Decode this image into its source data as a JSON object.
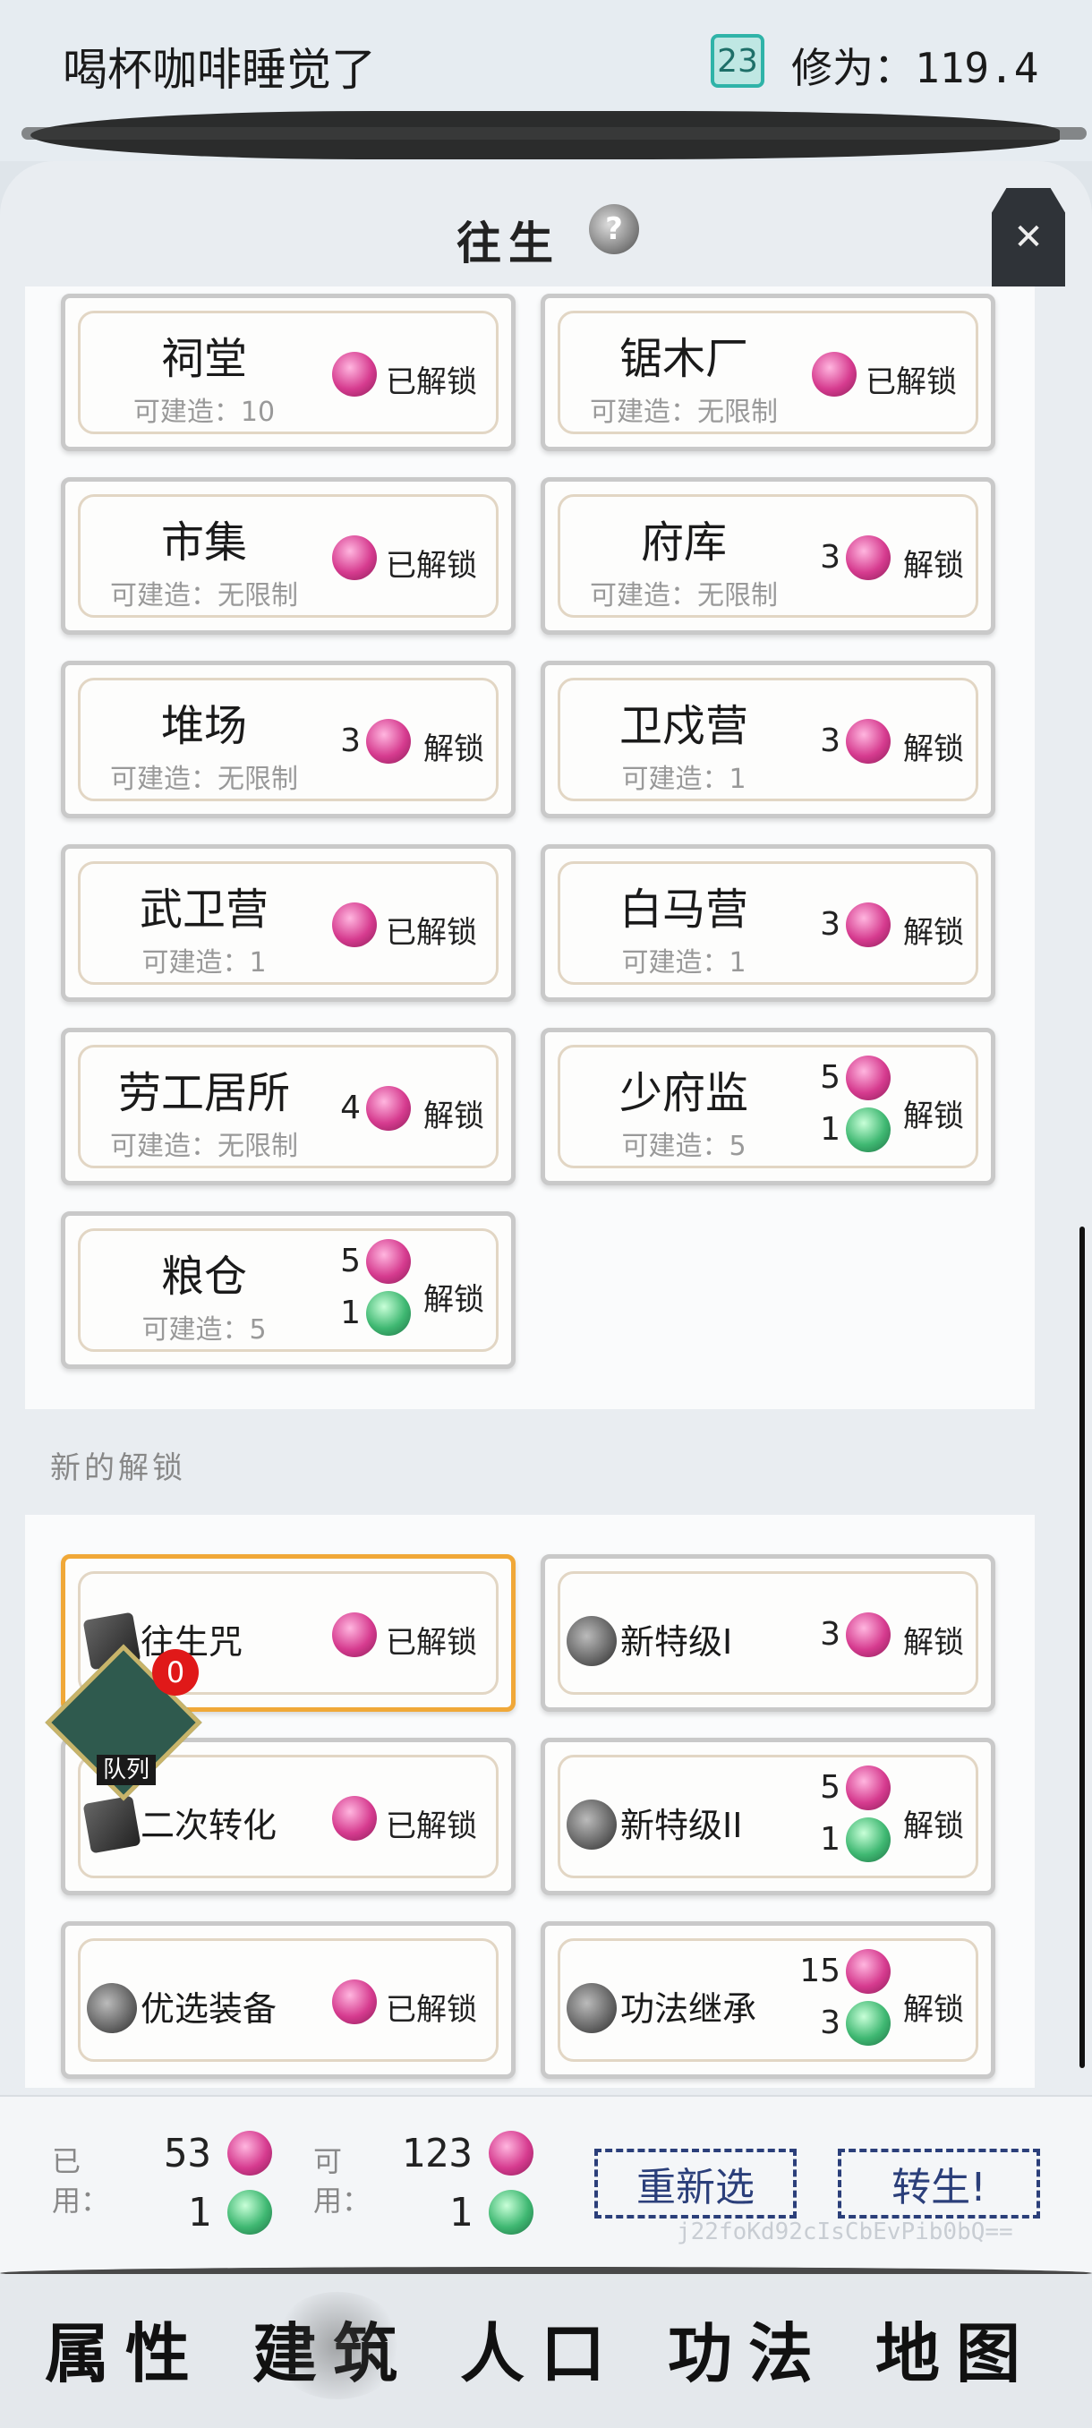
{
  "header": {
    "player_name": "喝杯咖啡睡觉了",
    "level": "23",
    "cultivation": "修为：119.4"
  },
  "panel": {
    "title": "往生"
  },
  "buildings": [
    {
      "name": "祠堂",
      "sub": "可建造：10",
      "costs": [],
      "status": "已解锁"
    },
    {
      "name": "锯木厂",
      "sub": "可建造：无限制",
      "costs": [],
      "status": "已解锁"
    },
    {
      "name": "市集",
      "sub": "可建造：无限制",
      "costs": [],
      "status": "已解锁"
    },
    {
      "name": "府库",
      "sub": "可建造：无限制",
      "costs": [
        {
          "n": "3",
          "orb": "pink"
        }
      ],
      "status": "解锁"
    },
    {
      "name": "堆场",
      "sub": "可建造：无限制",
      "costs": [
        {
          "n": "3",
          "orb": "pink"
        }
      ],
      "status": "解锁"
    },
    {
      "name": "卫戍营",
      "sub": "可建造：1",
      "costs": [
        {
          "n": "3",
          "orb": "pink"
        }
      ],
      "status": "解锁"
    },
    {
      "name": "武卫营",
      "sub": "可建造：1",
      "costs": [],
      "status": "已解锁"
    },
    {
      "name": "白马营",
      "sub": "可建造：1",
      "costs": [
        {
          "n": "3",
          "orb": "pink"
        }
      ],
      "status": "解锁"
    },
    {
      "name": "劳工居所",
      "sub": "可建造：无限制",
      "costs": [
        {
          "n": "4",
          "orb": "pink"
        }
      ],
      "status": "解锁"
    },
    {
      "name": "少府监",
      "sub": "可建造：5",
      "costs": [
        {
          "n": "5",
          "orb": "pink"
        },
        {
          "n": "1",
          "orb": "green"
        }
      ],
      "status": "解锁"
    },
    {
      "name": "粮仓",
      "sub": "可建造：5",
      "costs": [
        {
          "n": "5",
          "orb": "pink"
        },
        {
          "n": "1",
          "orb": "green"
        }
      ],
      "status": "解锁"
    }
  ],
  "new_unlocks_label": "新的解锁",
  "unlocks": [
    {
      "name": "往生咒",
      "icon": "book",
      "costs": [],
      "status": "已解锁",
      "selected": true
    },
    {
      "name": "新特级I",
      "icon": "help",
      "costs": [
        {
          "n": "3",
          "orb": "pink"
        }
      ],
      "status": "解锁"
    },
    {
      "name": "二次转化",
      "icon": "book",
      "costs": [],
      "status": "已解锁"
    },
    {
      "name": "新特级II",
      "icon": "help",
      "costs": [
        {
          "n": "5",
          "orb": "pink"
        },
        {
          "n": "1",
          "orb": "green"
        }
      ],
      "status": "解锁"
    },
    {
      "name": "优选装备",
      "icon": "help",
      "costs": [],
      "status": "已解锁"
    },
    {
      "name": "功法继承",
      "icon": "help",
      "costs": [
        {
          "n": "15",
          "orb": "pink"
        },
        {
          "n": "3",
          "orb": "green"
        }
      ],
      "status": "解锁"
    }
  ],
  "queue": {
    "label": "队列",
    "count": "0"
  },
  "footer": {
    "used_label": "已用：",
    "used_pink": "53",
    "used_green": "1",
    "avail_label": "可用：",
    "avail_pink": "123",
    "avail_green": "1",
    "reselect_label": "重新选",
    "rebirth_label": "转生!",
    "watermark": "j22foKd92cIsCbEvPib0bQ=="
  },
  "nav": [
    "属性",
    "建筑",
    "人口",
    "功法",
    "地图"
  ],
  "nav_active": "建筑"
}
